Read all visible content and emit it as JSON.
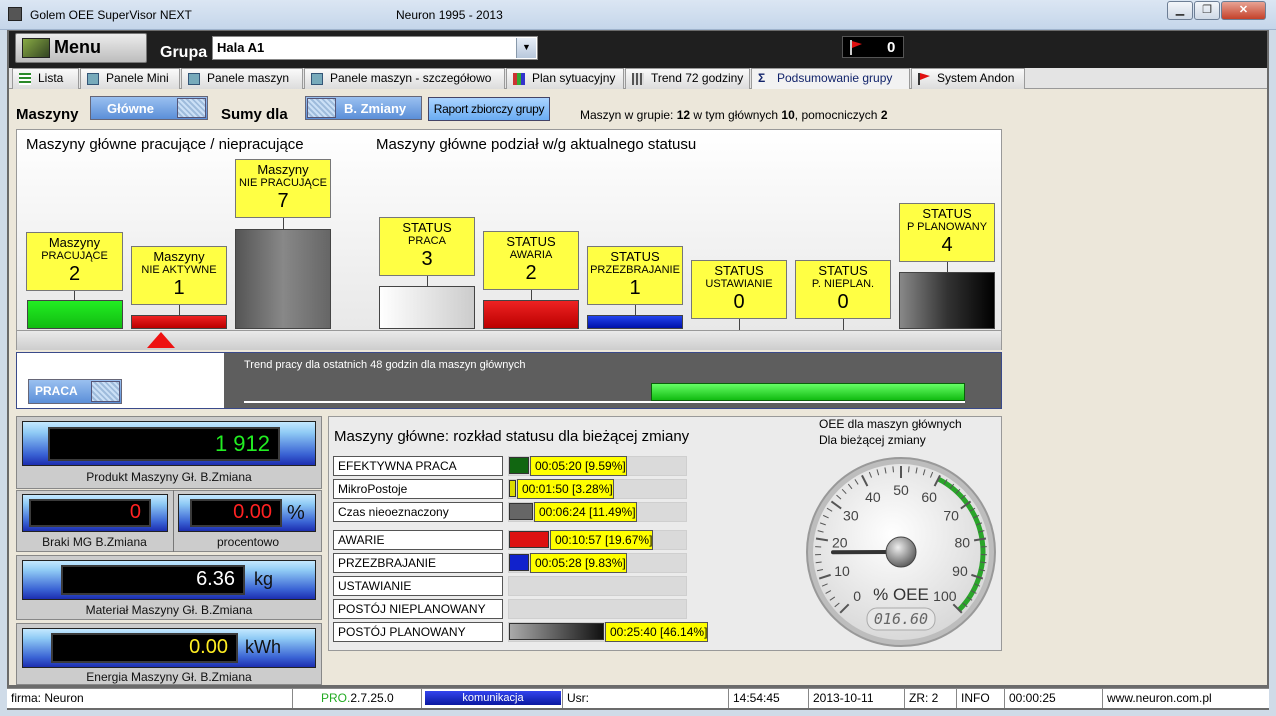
{
  "window": {
    "app_title": "Golem OEE SuperVisor NEXT",
    "center_title": "Neuron 1995 - 2013"
  },
  "topbar": {
    "menu_label": "Menu",
    "grupa_label": "Grupa",
    "grupa_value": "Hala A1",
    "alarm_count": "0"
  },
  "tabs": [
    {
      "label": "Lista",
      "icon": "list-icon"
    },
    {
      "label": "Panele Mini",
      "icon": "panels-icon"
    },
    {
      "label": "Panele maszyn",
      "icon": "panels-icon"
    },
    {
      "label": "Panele maszyn - szczegółowo",
      "icon": "panels-icon"
    },
    {
      "label": "Plan sytuacyjny",
      "icon": "map-icon"
    },
    {
      "label": "Trend 72 godziny",
      "icon": "trend-icon"
    },
    {
      "label": "Podsumowanie grupy",
      "icon": "sigma-icon",
      "active": true
    },
    {
      "label": "System Andon",
      "icon": "flag-icon"
    }
  ],
  "controls": {
    "maszyny_label": "Maszyny",
    "maszyny_toggle": "Główne",
    "sumy_label": "Sumy dla",
    "sumy_toggle": "B. Zmiany",
    "report_button": "Raport zbiorczy grupy",
    "info_prefix": "Maszyn w grupie: ",
    "info_total": "12",
    "info_mid": " w tym głównych ",
    "info_main": "10",
    "info_mid2": ", pomocniczych ",
    "info_aux": "2"
  },
  "panel_working": {
    "title_left": "Maszyny główne pracujące / niepracujące",
    "title_right": "Maszyny główne podział w/g aktualnego statusu",
    "left_boxes": [
      {
        "line1": "Maszyny",
        "line2": "PRACUJĄCE",
        "count": "2",
        "color": "#22cc22"
      },
      {
        "line1": "Maszyny",
        "line2": "NIE AKTYWNE",
        "count": "1",
        "color": "#dd1111"
      },
      {
        "line1": "Maszyny",
        "line2": "NIE PRACUJĄCE",
        "count": "7",
        "color": "#777777"
      }
    ],
    "status_boxes": [
      {
        "line1": "STATUS",
        "line2": "PRACA",
        "count": "3",
        "color": "#eeeeee"
      },
      {
        "line1": "STATUS",
        "line2": "AWARIA",
        "count": "2",
        "color": "#dd1111"
      },
      {
        "line1": "STATUS",
        "line2": "PRZEZBRAJANIE",
        "count": "1",
        "color": "#1133cc"
      },
      {
        "line1": "STATUS",
        "line2": "USTAWIANIE",
        "count": "0",
        "color": ""
      },
      {
        "line1": "STATUS",
        "line2": "P. NIEPLAN.",
        "count": "0",
        "color": ""
      },
      {
        "line1": "STATUS",
        "line2": "P PLANOWANY",
        "count": "4",
        "color": "#222222"
      }
    ]
  },
  "trend": {
    "toggle_label": "PRACA",
    "title": "Trend pracy dla ostatnich 48 godzin dla maszyn głównych"
  },
  "metrics": {
    "produkt_value": "1 912",
    "produkt_caption": "Produkt Maszyny Gł. B.Zmiana",
    "braki_value": "0",
    "braki_caption": "Braki MG B.Zmiana",
    "procent_value": "0.00",
    "procent_unit": "%",
    "procent_caption": "procentowo",
    "material_value": "6.36",
    "material_unit": "kg",
    "material_caption": "Materiał Maszyny Gł. B.Zmiana",
    "energia_value": "0.00",
    "energia_unit": "kWh",
    "energia_caption": "Energia Maszyny Gł. B.Zmiana"
  },
  "status_dist": {
    "title": "Maszyny główne: rozkład statusu dla bieżącej zmiany",
    "rows": [
      {
        "label": "EFEKTYWNA PRACA",
        "value": "00:05:20  [9.59%]",
        "pct": 9.59,
        "color": "#116611"
      },
      {
        "label": "MikroPostoje",
        "value": "00:01:50  [3.28%]",
        "pct": 3.28,
        "color": "#dddd00"
      },
      {
        "label": "Czas nieoeznaczony",
        "value": "00:06:24  [11.49%]",
        "pct": 11.49,
        "color": "#666666"
      },
      {
        "label": "AWARIE",
        "value": "00:10:57  [19.67%]",
        "pct": 19.67,
        "color": "#dd1111"
      },
      {
        "label": "PRZEZBRAJANIE",
        "value": "00:05:28  [9.83%]",
        "pct": 9.83,
        "color": "#1122cc"
      },
      {
        "label": "USTAWIANIE",
        "value": "",
        "pct": 0,
        "color": ""
      },
      {
        "label": "POSTÓJ NIEPLANOWANY",
        "value": "",
        "pct": 0,
        "color": ""
      },
      {
        "label": "POSTÓJ PLANOWANY",
        "value": "00:25:40  [46.14%]",
        "pct": 46.14,
        "color": "#222222"
      }
    ]
  },
  "gauge": {
    "title_line1": "OEE dla maszyn głównych",
    "title_line2": "Dla bieżącej zmiany",
    "label": "% OEE",
    "readout": "016.60",
    "value": 16.6,
    "ticks": [
      "0",
      "10",
      "20",
      "30",
      "40",
      "50",
      "60",
      "70",
      "80",
      "90",
      "100"
    ]
  },
  "statusbar": {
    "firma": "firma: Neuron",
    "version_prefix": "PRO.",
    "version": "2.7.25.0",
    "komunikacja": "komunikacja",
    "usr": "Usr:",
    "time": "14:54:45",
    "date": "2013-10-11",
    "zr": "ZR: 2",
    "info": "INFO",
    "elapsed": "00:00:25",
    "url": "www.neuron.com.pl"
  }
}
